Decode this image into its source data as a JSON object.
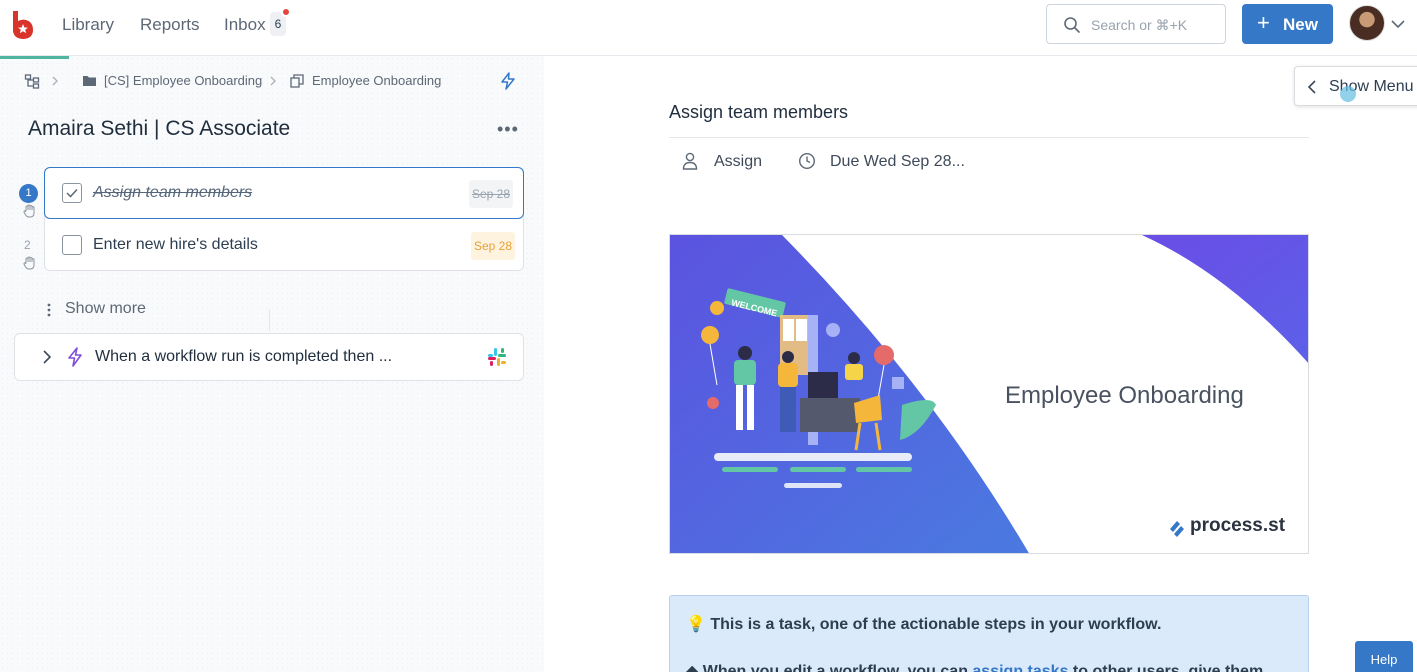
{
  "nav": {
    "library": "Library",
    "reports": "Reports",
    "inbox": "Inbox",
    "inbox_count": "6",
    "search_placeholder": "Search or ⌘+K",
    "new_button": "New"
  },
  "breadcrumb": {
    "folder": "[CS] Employee Onboarding",
    "workflow": "Employee Onboarding"
  },
  "run": {
    "title": "Amaira Sethi | CS Associate",
    "tasks": [
      {
        "number": "1",
        "name": "Assign team members",
        "due": "Sep 28",
        "completed": true
      },
      {
        "number": "2",
        "name": "Enter new hire's details",
        "due": "Sep 28",
        "completed": false
      }
    ],
    "show_more": "Show more",
    "automation": "When a workflow run is completed then ..."
  },
  "task_detail": {
    "title": "Assign team members",
    "assign": "Assign",
    "due": "Due Wed Sep 28...",
    "banner_title": "Employee Onboarding",
    "banner_brand": "process.st",
    "banner_sign": "WELCOME",
    "info_line_1": "💡 This is a task, one of the actionable steps in your workflow.",
    "info_line_2_pre": "◆ When you edit a workflow, you can ",
    "info_line_2_link": "assign tasks",
    "info_line_2_post": " to other users, give them"
  },
  "show_menu": "Show Menu",
  "help": "Help",
  "colors": {
    "accent": "#3578c8",
    "brand_red": "#d9342b",
    "due_orange": "#e6a23c",
    "banner_purple": "#6a4de6",
    "progress": "#4fb5a0"
  }
}
